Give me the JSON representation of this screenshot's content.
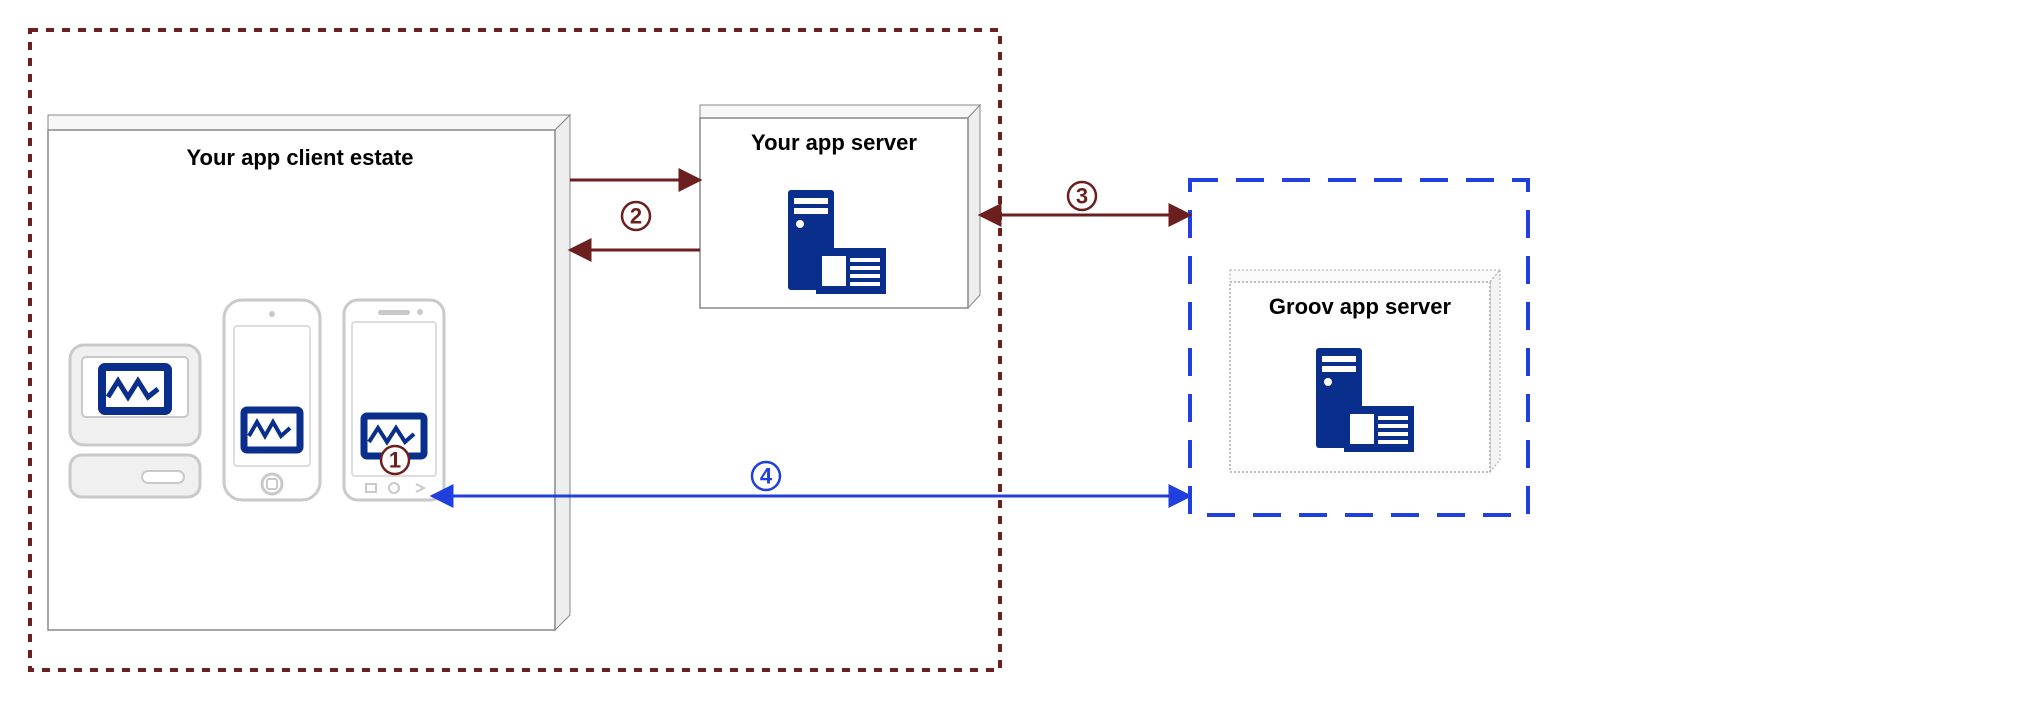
{
  "boxes": {
    "client_estate": {
      "label": "Your  app client estate"
    },
    "your_server": {
      "label": "Your app server"
    },
    "groov_server": {
      "label": "Groov app server"
    }
  },
  "steps": {
    "s1": "1",
    "s2": "2",
    "s3": "3",
    "s4": "4"
  },
  "colors": {
    "maroon": "#6b1f1f",
    "blue": "#1f3fde",
    "navy": "#0a2e8c",
    "grey": "#d6d6d6",
    "lightgrey": "#f0f0f0"
  }
}
